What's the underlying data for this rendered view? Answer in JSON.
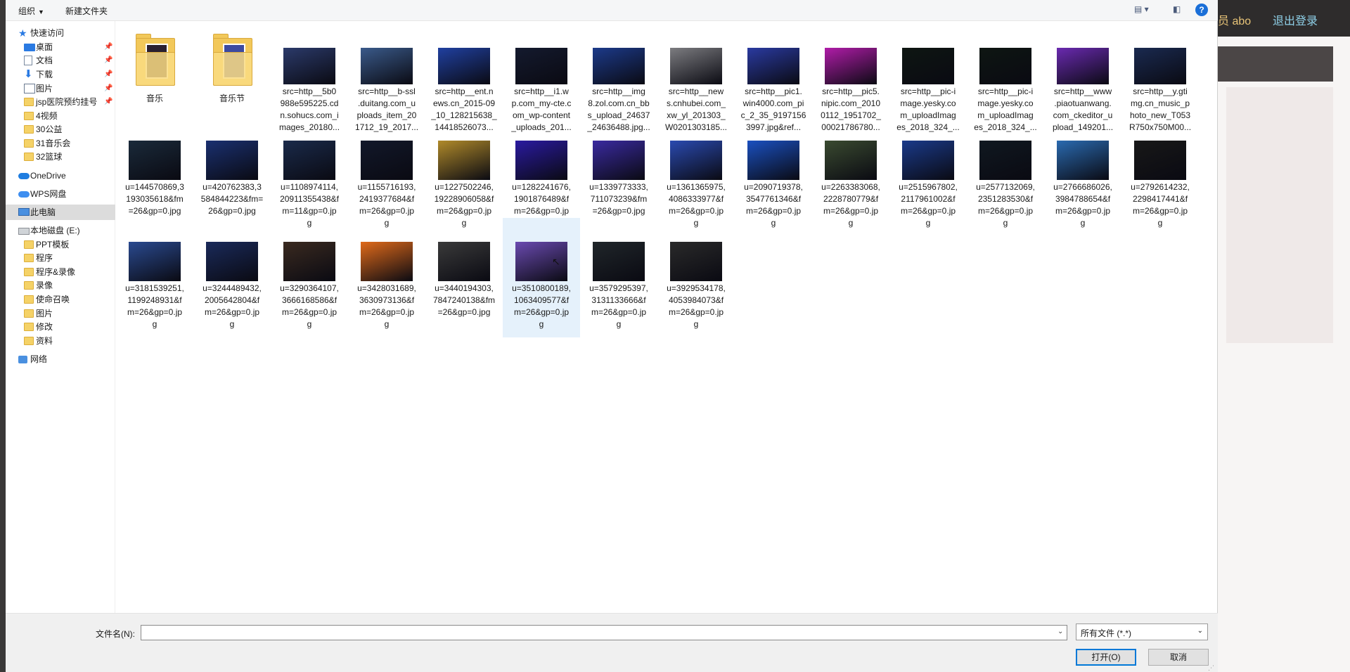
{
  "background_page": {
    "user_text": "员 abo",
    "logout": "退出登录"
  },
  "toolbar": {
    "organize": "组织",
    "new_folder": "新建文件夹",
    "help": "?"
  },
  "nav": {
    "items": [
      {
        "label": "快速访问",
        "icon": "star-icon",
        "pinned": false
      },
      {
        "label": "桌面",
        "icon": "desktop-icon",
        "pinned": true
      },
      {
        "label": "文档",
        "icon": "document-icon",
        "pinned": true
      },
      {
        "label": "下载",
        "icon": "download-icon",
        "pinned": true
      },
      {
        "label": "图片",
        "icon": "pictures-icon",
        "pinned": true
      },
      {
        "label": "jsp医院预约挂号",
        "icon": "folder-icon",
        "pinned": true
      },
      {
        "label": "4视频",
        "icon": "folder-icon",
        "pinned": false
      },
      {
        "label": "30公益",
        "icon": "folder-icon",
        "pinned": false
      },
      {
        "label": "31音乐会",
        "icon": "folder-icon",
        "pinned": false
      },
      {
        "label": "32篮球",
        "icon": "folder-icon",
        "pinned": false
      },
      {
        "label": "OneDrive",
        "icon": "onedrive-icon",
        "pinned": false
      },
      {
        "label": "WPS网盘",
        "icon": "wps-cloud-icon",
        "pinned": false
      },
      {
        "label": "此电脑",
        "icon": "this-pc-icon",
        "pinned": false
      },
      {
        "label": "本地磁盘 (E:)",
        "icon": "drive-icon",
        "pinned": false
      },
      {
        "label": "PPT模板",
        "icon": "folder-icon",
        "pinned": false
      },
      {
        "label": "程序",
        "icon": "folder-icon",
        "pinned": false
      },
      {
        "label": "程序&录像",
        "icon": "folder-icon",
        "pinned": false
      },
      {
        "label": "录像",
        "icon": "folder-icon",
        "pinned": false
      },
      {
        "label": "使命召唤",
        "icon": "folder-icon",
        "pinned": false
      },
      {
        "label": "图片",
        "icon": "folder-icon",
        "pinned": false
      },
      {
        "label": "修改",
        "icon": "folder-icon",
        "pinned": false
      },
      {
        "label": "资料",
        "icon": "folder-icon",
        "pinned": false
      },
      {
        "label": "网络",
        "icon": "network-icon",
        "pinned": false
      }
    ],
    "selected_index": 12
  },
  "files": [
    {
      "name": "音乐",
      "type": "folder",
      "thumb_color": "#2a2030"
    },
    {
      "name": "音乐节",
      "type": "folder",
      "thumb_color": "#3c4aa0"
    },
    {
      "name": "src=http__5b0\n988e595225.cd\nn.sohucs.com_i\nmages_20180...",
      "type": "image",
      "thumb_color": "#2b3a6a"
    },
    {
      "name": "src=http__b-ssl\n.duitang.com_u\nploads_item_20\n1712_19_2017...",
      "type": "image",
      "thumb_color": "#3a5a8a"
    },
    {
      "name": "src=http__ent.n\news.cn_2015-09\n_10_128215638_\n14418526073...",
      "type": "image",
      "thumb_color": "#2040a0"
    },
    {
      "name": "src=http__i1.w\np.com_my-cte.c\nom_wp-content\n_uploads_201...",
      "type": "image",
      "thumb_color": "#141a2e"
    },
    {
      "name": "src=http__img\n8.zol.com.cn_bb\ns_upload_24637\n_24636488.jpg...",
      "type": "image",
      "thumb_color": "#1c3a8a"
    },
    {
      "name": "src=http__new\ns.cnhubei.com_\nxw_yl_201303_\nW0201303185...",
      "type": "image",
      "thumb_color": "#7c7c80"
    },
    {
      "name": "src=http__pic1.\nwin4000.com_pi\nc_2_35_9197156\n3997.jpg&ref...",
      "type": "image",
      "thumb_color": "#2a3aa0"
    },
    {
      "name": "src=http__pic5.\nnipic.com_2010\n0112_1951702_\n00021786780...",
      "type": "image",
      "thumb_color": "#b01ca8"
    },
    {
      "name": "src=http__pic-i\nmage.yesky.co\nm_uploadImag\nes_2018_324_...",
      "type": "image",
      "thumb_color": "#0e1612"
    },
    {
      "name": "src=http__pic-i\nmage.yesky.co\nm_uploadImag\nes_2018_324_...",
      "type": "image",
      "thumb_color": "#0e1612"
    },
    {
      "name": "src=http__www\n.piaotuanwang.\ncom_ckeditor_u\npload_149201...",
      "type": "image",
      "thumb_color": "#6a2ab0"
    },
    {
      "name": "src=http__y.gti\nmg.cn_music_p\nhoto_new_T053\nR750x750M00...",
      "type": "image",
      "thumb_color": "#1a2a50"
    },
    {
      "name": "u=144570869,3\n193035618&fm\n=26&gp=0.jpg",
      "type": "image",
      "thumb_color": "#1a2a3a"
    },
    {
      "name": "u=420762383,3\n584844223&fm=\n26&gp=0.jpg",
      "type": "image",
      "thumb_color": "#1a3070"
    },
    {
      "name": "u=1108974114,\n20911355438&f\nm=11&gp=0.jp\ng",
      "type": "image",
      "thumb_color": "#1a2a4a"
    },
    {
      "name": "u=1155716193,\n2419377684&f\nm=26&gp=0.jp\ng",
      "type": "image",
      "thumb_color": "#12182a"
    },
    {
      "name": "u=1227502246,\n19228906058&f\nm=26&gp=0.jp\ng",
      "type": "image",
      "thumb_color": "#b08a2a"
    },
    {
      "name": "u=1282241676,\n1901876489&f\nm=26&gp=0.jp\ng",
      "type": "image",
      "thumb_color": "#2a1aa0"
    },
    {
      "name": "u=1339773333,\n711073239&fm\n=26&gp=0.jpg",
      "type": "image",
      "thumb_color": "#3a2aa0"
    },
    {
      "name": "u=1361365975,\n4086333977&f\nm=26&gp=0.jp\ng",
      "type": "image",
      "thumb_color": "#2a4ab0"
    },
    {
      "name": "u=2090719378,\n3547761346&f\nm=26&gp=0.jp\ng",
      "type": "image",
      "thumb_color": "#1a50c0"
    },
    {
      "name": "u=2263383068,\n2228780779&f\nm=26&gp=0.jp\ng",
      "type": "image",
      "thumb_color": "#3a4a30"
    },
    {
      "name": "u=2515967802,\n2117961002&f\nm=26&gp=0.jp\ng",
      "type": "image",
      "thumb_color": "#1a3a8a"
    },
    {
      "name": "u=2577132069,\n2351283530&f\nm=26&gp=0.jp\ng",
      "type": "image",
      "thumb_color": "#101820"
    },
    {
      "name": "u=2766686026,\n3984788654&f\nm=26&gp=0.jp\ng",
      "type": "image",
      "thumb_color": "#2a6ab0"
    },
    {
      "name": "u=2792614232,\n2298417441&f\nm=26&gp=0.jp\ng",
      "type": "image",
      "thumb_color": "#181818"
    },
    {
      "name": "u=3181539251,\n1199248931&f\nm=26&gp=0.jp\ng",
      "type": "image",
      "thumb_color": "#2a4a90"
    },
    {
      "name": "u=3244489432,\n2005642804&f\nm=26&gp=0.jp\ng",
      "type": "image",
      "thumb_color": "#1a2a5a"
    },
    {
      "name": "u=3290364107,\n3666168586&f\nm=26&gp=0.jp\ng",
      "type": "image",
      "thumb_color": "#3a2a20"
    },
    {
      "name": "u=3428031689,\n3630973136&f\nm=26&gp=0.jp\ng",
      "type": "image",
      "thumb_color": "#e06a1a"
    },
    {
      "name": "u=3440194303,\n7847240138&fm\n=26&gp=0.jpg",
      "type": "image",
      "thumb_color": "#3a3a3a"
    },
    {
      "name": "u=3510800189,\n1063409577&f\nm=26&gp=0.jp\ng",
      "type": "image",
      "thumb_color": "#6a4ab0",
      "selected": true
    },
    {
      "name": "u=3579295397,\n3131133666&f\nm=26&gp=0.jp\ng",
      "type": "image",
      "thumb_color": "#20262a"
    },
    {
      "name": "u=3929534178,\n4053984073&f\nm=26&gp=0.jp\ng",
      "type": "image",
      "thumb_color": "#2a2a2a"
    }
  ],
  "bottom": {
    "filename_label": "文件名(N):",
    "filename_value": "",
    "filter": "所有文件 (*.*)",
    "open": "打开(O)",
    "cancel": "取消"
  }
}
